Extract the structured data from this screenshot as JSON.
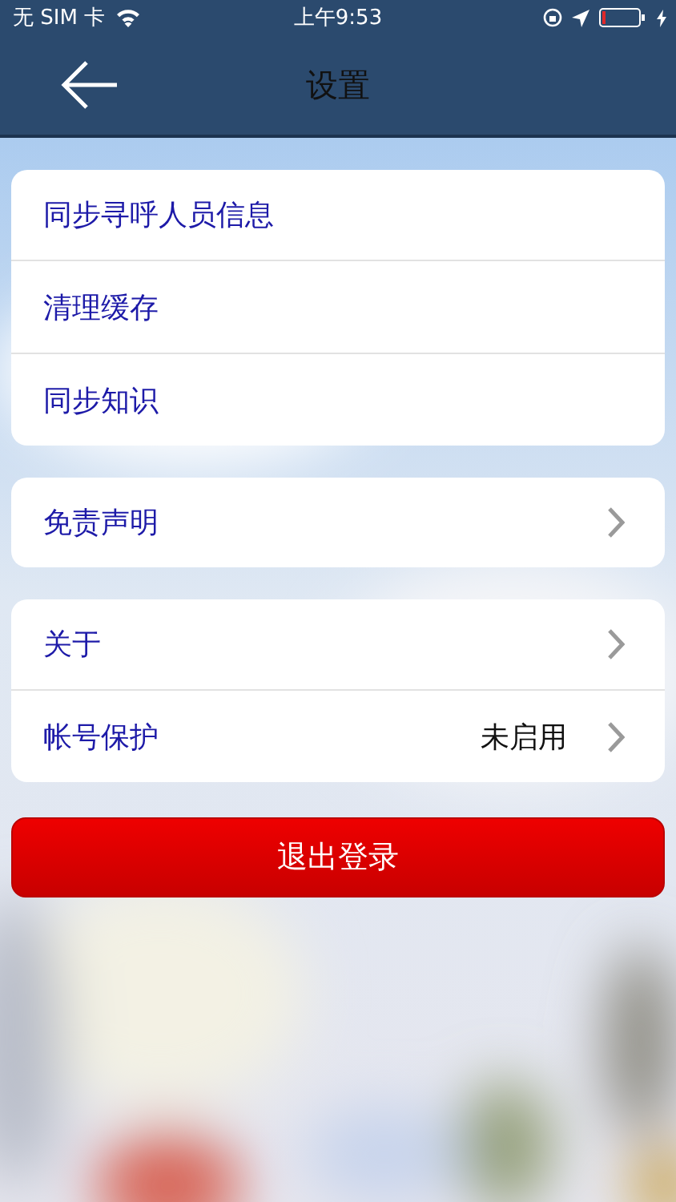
{
  "status_bar": {
    "carrier": "无 SIM 卡",
    "time": "上午9:53"
  },
  "nav": {
    "title": "设置"
  },
  "groups": [
    {
      "rows": [
        {
          "label": "同步寻呼人员信息",
          "chevron": false
        },
        {
          "label": "清理缓存",
          "chevron": false
        },
        {
          "label": "同步知识",
          "chevron": false
        }
      ]
    },
    {
      "rows": [
        {
          "label": "免责声明",
          "chevron": true
        }
      ]
    },
    {
      "rows": [
        {
          "label": "关于",
          "chevron": true
        },
        {
          "label": "帐号保护",
          "value": "未启用",
          "chevron": true
        }
      ]
    }
  ],
  "logout_button": "退出登录"
}
